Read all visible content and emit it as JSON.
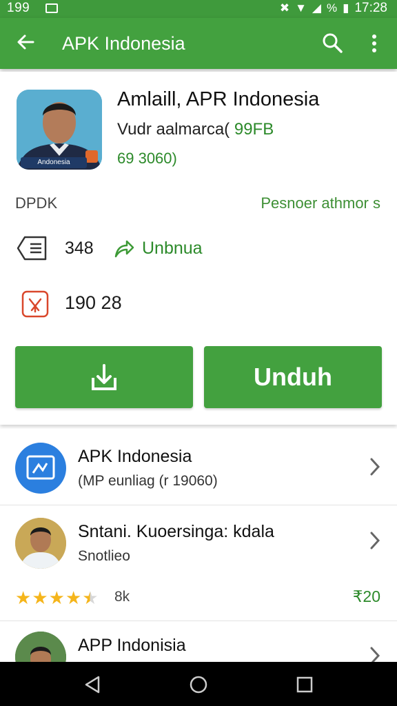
{
  "status_bar": {
    "left_text": "199",
    "right_time": "17:28",
    "signal_text": "%"
  },
  "app_bar": {
    "title": "APK Indonesia"
  },
  "app": {
    "name": "Amlaill, APR Indonesia",
    "subtitle": "Vudr aalmarca(",
    "size": "99FB",
    "version": "69 3060)",
    "avatar_badge": "Andonesia",
    "label_left": "DPDK",
    "label_right": "Pesnoer athmor s",
    "stat_count": "348",
    "update_label": "Unbnua",
    "second_count": "190 28",
    "button_label": "Unduh"
  },
  "list": [
    {
      "title": "APK Indonesia",
      "sub": "(MP eunliag (r 19060)"
    },
    {
      "title": "Sntani. Kuoersinga: kdala",
      "sub": "Snotlieo",
      "rating": 4.5,
      "count": "8k",
      "price": "₹20"
    },
    {
      "title": "APP Indonisia"
    }
  ],
  "colors": {
    "primary": "#43a13f",
    "status": "#3f9a3c",
    "accent_text": "#2c8a2a",
    "star": "#f5b51b"
  },
  "icons": [
    "back-arrow-icon",
    "search-icon",
    "more-vert-icon",
    "list-icon",
    "share-icon",
    "apk-file-icon",
    "download-icon",
    "chevron-right-icon",
    "star-icon",
    "nav-back-icon",
    "nav-home-icon",
    "nav-recents-icon"
  ]
}
